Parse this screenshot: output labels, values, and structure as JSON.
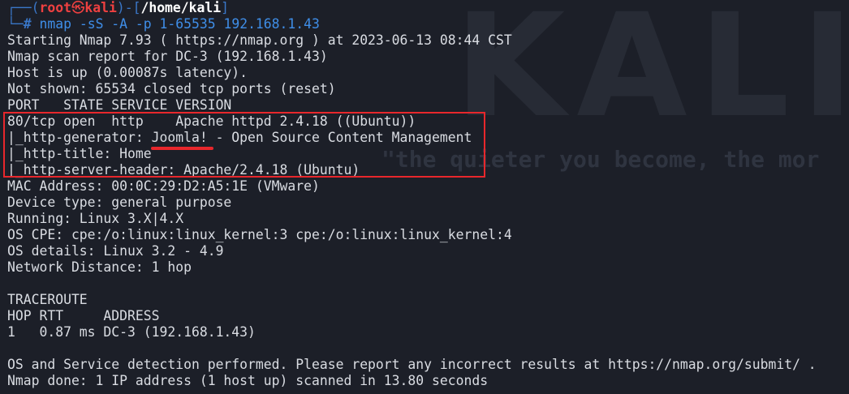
{
  "watermark": {
    "brand": "KALI LI",
    "quote": "\"the quieter you become, the mor"
  },
  "prompt": {
    "corner_top": "┌──(",
    "user": "root",
    "skull": "㉿",
    "host": "kali",
    "close": ")-[",
    "path": "/home/kali",
    "end": "]",
    "corner_bottom": "└─",
    "hash": "# ",
    "command": "nmap -sS -A -p 1-65535 192.168.1.43"
  },
  "output": [
    "Starting Nmap 7.93 ( https://nmap.org ) at 2023-06-13 08:44 CST",
    "Nmap scan report for DC-3 (192.168.1.43)",
    "Host is up (0.00087s latency).",
    "Not shown: 65534 closed tcp ports (reset)",
    "PORT   STATE SERVICE VERSION",
    "80/tcp open  http    Apache httpd 2.4.18 ((Ubuntu))",
    "|_http-generator: Joomla! - Open Source Content Management",
    "|_http-title: Home",
    "|_http-server-header: Apache/2.4.18 (Ubuntu)",
    "MAC Address: 00:0C:29:D2:A5:1E (VMware)",
    "Device type: general purpose",
    "Running: Linux 3.X|4.X",
    "OS CPE: cpe:/o:linux:linux_kernel:3 cpe:/o:linux:linux_kernel:4",
    "OS details: Linux 3.2 - 4.9",
    "Network Distance: 1 hop",
    "",
    "TRACEROUTE",
    "HOP RTT     ADDRESS",
    "1   0.87 ms DC-3 (192.168.1.43)",
    "",
    "OS and Service detection performed. Please report any incorrect results at https://nmap.org/submit/ .",
    "Nmap done: 1 IP address (1 host up) scanned in 13.80 seconds"
  ],
  "colors": {
    "background": "#1c1f28",
    "text": "#d9dce2",
    "prompt_blue": "#3a77c8",
    "root_red": "#ee4040",
    "highlight_red": "#e8272c"
  }
}
